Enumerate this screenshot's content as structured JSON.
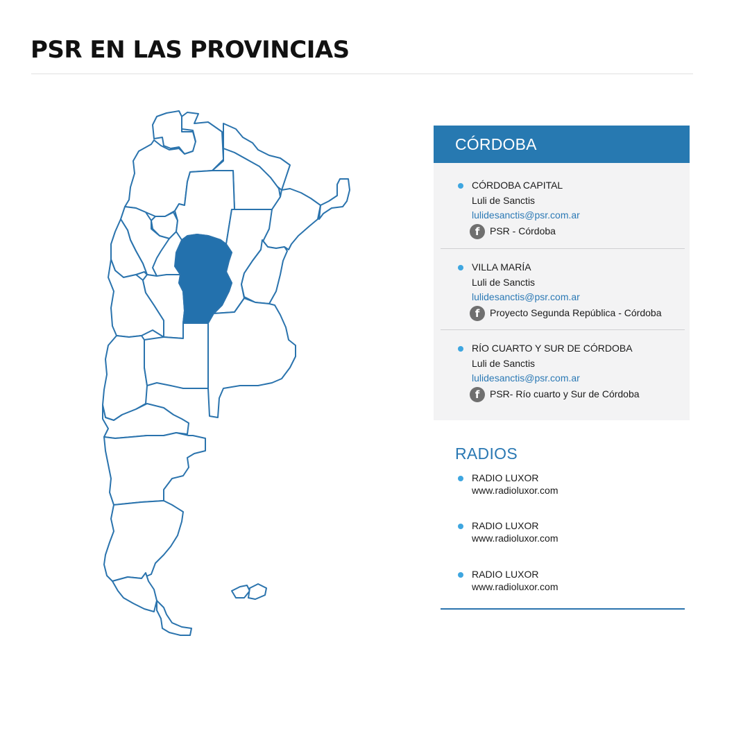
{
  "page": {
    "title": "PSR EN LAS PROVINCIAS"
  },
  "map": {
    "highlighted": "Córdoba",
    "accent": "#2371ad",
    "outline": "#2a73ad"
  },
  "province_card": {
    "title": "CÓRDOBA",
    "header_color": "#2779b1",
    "entries": [
      {
        "name": "CÓRDOBA CAPITAL",
        "person": "Luli de Sanctis",
        "email": "lulidesanctis@psr.com.ar",
        "facebook": "PSR - Córdoba",
        "icon": "facebook-icon"
      },
      {
        "name": "VILLA MARÍA",
        "person": "Luli de Sanctis",
        "email": "lulidesanctis@psr.com.ar",
        "facebook": "Proyecto Segunda República - Córdoba",
        "icon": "facebook-icon"
      },
      {
        "name": "RÍO CUARTO Y SUR DE CÓRDOBA",
        "person": "Luli de Sanctis",
        "email": "lulidesanctis@psr.com.ar",
        "facebook": "PSR- Río cuarto y Sur de Córdoba",
        "icon": "facebook-icon"
      }
    ]
  },
  "radios": {
    "title": "RADIOS",
    "items": [
      {
        "name": "RADIO LUXOR",
        "url": "www.radioluxor.com"
      },
      {
        "name": "RADIO LUXOR",
        "url": "www.radioluxor.com"
      },
      {
        "name": "RADIO LUXOR",
        "url": "www.radioluxor.com"
      }
    ]
  }
}
